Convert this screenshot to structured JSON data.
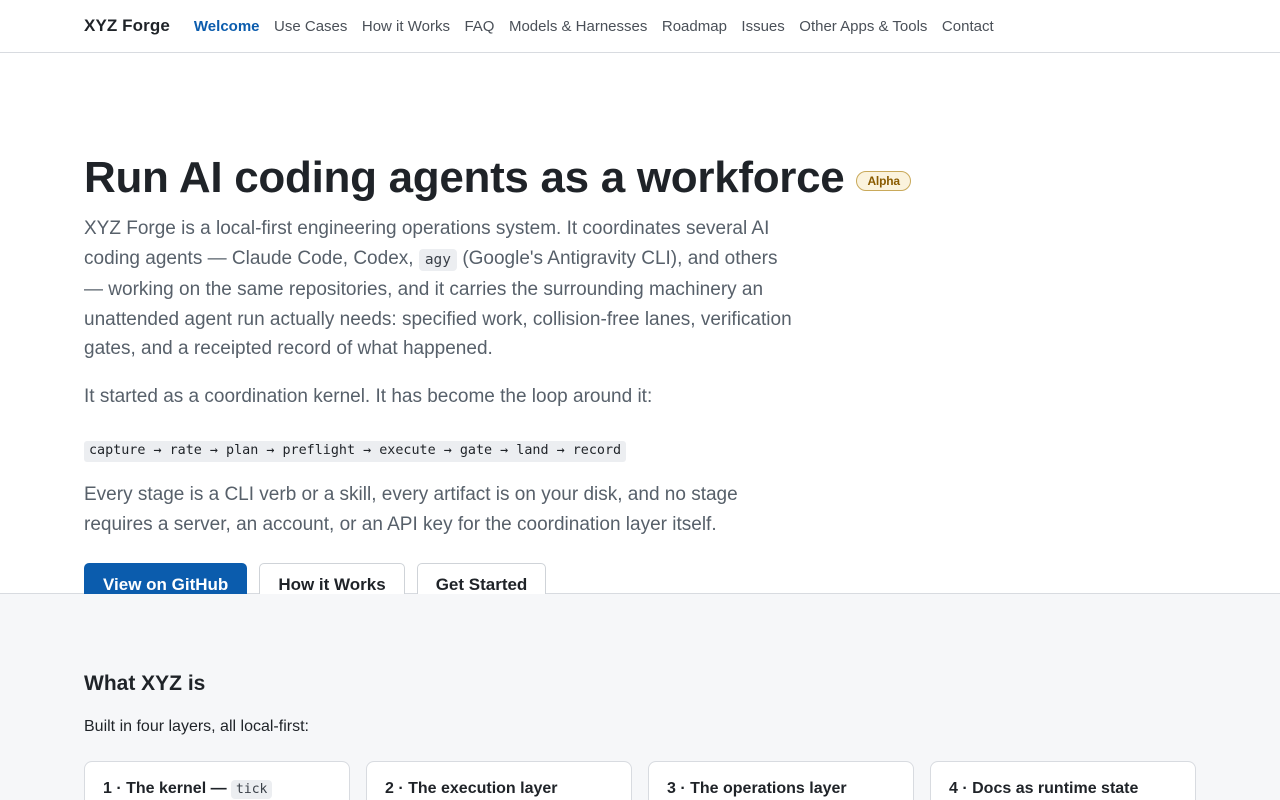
{
  "nav": {
    "brand": "XYZ Forge",
    "links": [
      "Welcome",
      "Use Cases",
      "How it Works",
      "FAQ",
      "Models & Harnesses",
      "Roadmap",
      "Issues",
      "Other Apps & Tools",
      "Contact"
    ],
    "active": "Welcome"
  },
  "hero": {
    "title": "Run AI coding agents as a workforce",
    "badge": "Alpha",
    "lede_before": "XYZ Forge is a local-first engineering operations system. It coordinates several AI coding agents — Claude Code, Codex,",
    "lede_code": "agy",
    "lede_after": "(Google's Antigravity CLI), and others — working on the same repositories, and it carries the surrounding machinery an unattended agent run actually needs: specified work, collision-free lanes, verification gates, and a receipted record of what happened.",
    "para2": "It started as a coordination kernel. It has become the loop around it:",
    "pipeline": "capture → rate → plan → preflight → execute → gate → land → record",
    "para3": "Every stage is a CLI verb or a skill, every artifact is on your disk, and no stage requires a server, an account, or an API key for the coordination layer itself.",
    "buttons": {
      "github": "View on GitHub",
      "how": "How it Works",
      "start": "Get Started"
    }
  },
  "section": {
    "title": "What XYZ is",
    "subtitle": "Built in four layers, all local-first:",
    "cards": [
      {
        "label": "1 · The kernel —",
        "code": "tick"
      },
      {
        "label": "2 · The execution layer",
        "code": ""
      },
      {
        "label": "3 · The operations layer",
        "code": ""
      },
      {
        "label": "4 · Docs as runtime state",
        "code": ""
      }
    ]
  },
  "colors": {
    "accent": "#0b5cad",
    "badge_bg": "#fbf3dd",
    "badge_text": "#8a5b00",
    "section_bg": "#f6f7f9"
  }
}
